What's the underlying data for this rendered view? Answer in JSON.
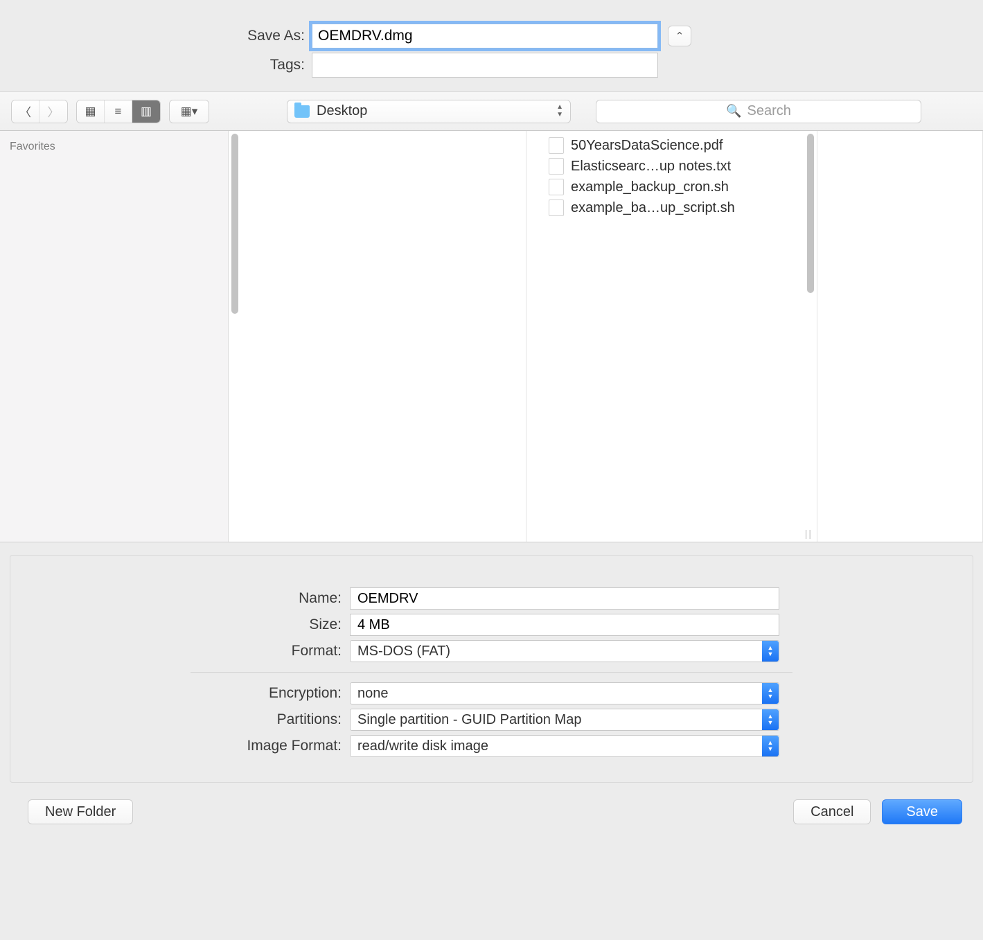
{
  "header": {
    "save_as_label": "Save As:",
    "save_as_value": "OEMDRV.dmg",
    "tags_label": "Tags:",
    "tags_value": ""
  },
  "toolbar": {
    "location": "Desktop",
    "search_placeholder": "Search"
  },
  "sidebar": {
    "favorites_label": "Favorites"
  },
  "files": [
    {
      "name": "50YearsDataScience.pdf",
      "kind": "pdf"
    },
    {
      "name": "Elasticsearc…up notes.txt",
      "kind": "text"
    },
    {
      "name": "example_backup_cron.sh",
      "kind": "shell"
    },
    {
      "name": "example_ba…up_script.sh",
      "kind": "shell"
    }
  ],
  "options": {
    "name_label": "Name:",
    "name_value": "OEMDRV",
    "size_label": "Size:",
    "size_value": "4 MB",
    "format_label": "Format:",
    "format_value": "MS-DOS (FAT)",
    "encryption_label": "Encryption:",
    "encryption_value": "none",
    "partitions_label": "Partitions:",
    "partitions_value": "Single partition - GUID Partition Map",
    "image_format_label": "Image Format:",
    "image_format_value": "read/write disk image"
  },
  "footer": {
    "new_folder": "New Folder",
    "cancel": "Cancel",
    "save": "Save"
  }
}
